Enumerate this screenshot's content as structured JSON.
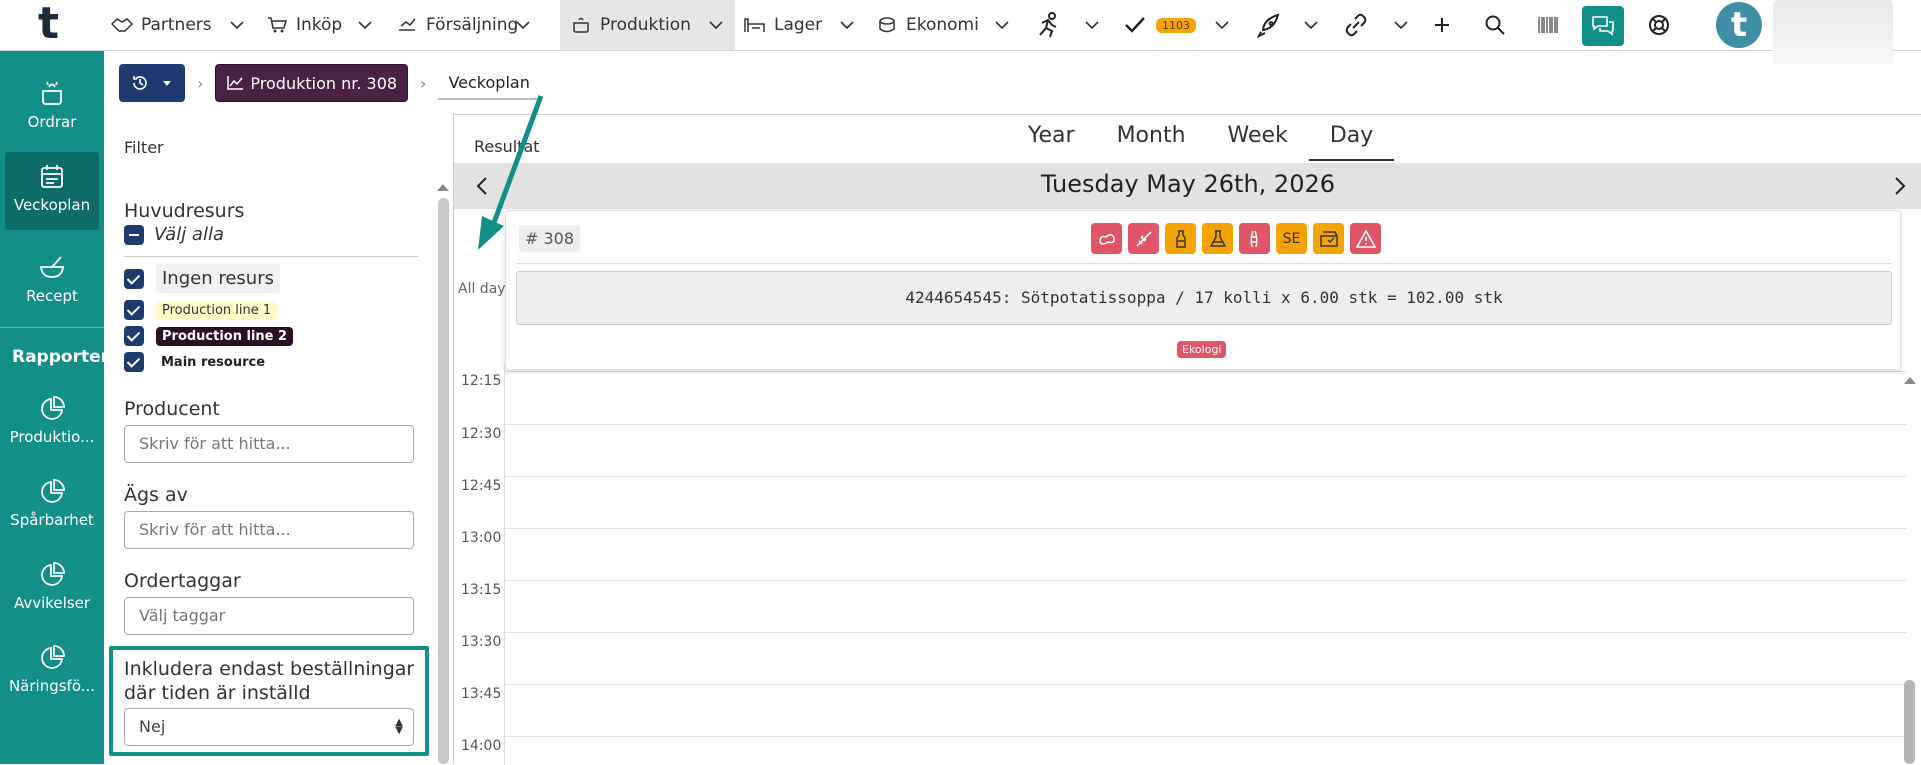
{
  "app": {
    "logo": "t"
  },
  "topnav": {
    "items": [
      {
        "label": "Partners",
        "icon": "handshake-icon"
      },
      {
        "label": "Inköp",
        "icon": "cart-icon"
      },
      {
        "label": "Försäljning",
        "icon": "sales-icon"
      },
      {
        "label": "Produktion",
        "icon": "pot-icon",
        "active": true
      },
      {
        "label": "Lager",
        "icon": "warehouse-icon"
      },
      {
        "label": "Ekonomi",
        "icon": "coins-icon"
      }
    ],
    "tasks_badge": "1103",
    "avatar_letter": "t"
  },
  "sidebar": {
    "items": [
      {
        "label": "Ordrar",
        "icon": "pot-icon"
      },
      {
        "label": "Veckoplan",
        "icon": "calendar-icon",
        "active": true
      },
      {
        "label": "Recept",
        "icon": "bowl-icon"
      }
    ],
    "reports_heading": "Rapporter",
    "reports": [
      {
        "label": "Produktio...",
        "icon": "pie-chart-icon"
      },
      {
        "label": "Spårbarhet",
        "icon": "pie-chart-icon"
      },
      {
        "label": "Avvikelser",
        "icon": "pie-chart-icon"
      },
      {
        "label": "Näringsfö...",
        "icon": "pie-chart-icon"
      }
    ]
  },
  "breadcrumb": {
    "production": "Produktion nr. 308",
    "current": "Veckoplan"
  },
  "filter": {
    "title": "Filter",
    "huvudresurs_label": "Huvudresurs",
    "select_all": "Välj alla",
    "resources": [
      "Ingen resurs",
      "Production line 1",
      "Production line 2",
      "Main resource"
    ],
    "producent_label": "Producent",
    "producent_placeholder": "Skriv för att hitta...",
    "ags_av_label": "Ägs av",
    "ags_av_placeholder": "Skriv för att hitta...",
    "ordertaggar_label": "Ordertaggar",
    "ordertaggar_placeholder": "Välj taggar",
    "include_label_1": "Inkludera endast beställningar",
    "include_label_2": "där tiden är inställd",
    "include_value": "Nej"
  },
  "calendar": {
    "tabs": [
      "Year",
      "Month",
      "Week",
      "Day"
    ],
    "active_tab": "Day",
    "resultat_label": "Resultat",
    "date": "Tuesday May 26th, 2026",
    "allday_label": "All day",
    "times": [
      "12:15",
      "12:30",
      "12:45",
      "13:00",
      "13:15",
      "13:30",
      "13:45",
      "14:00"
    ]
  },
  "event": {
    "order_no": "# 308",
    "description": "4244654545: Sötpotatissoppa / 17 kolli x 6.00 stk = 102.00 stk",
    "tag": "Ekologi",
    "icons": [
      {
        "name": "allergen-gluten-icon",
        "color": "#e05567"
      },
      {
        "name": "allergen-wheat-icon",
        "color": "#e05567"
      },
      {
        "name": "bottle-icon",
        "color": "#f5a300"
      },
      {
        "name": "flask-icon",
        "color": "#f5a300"
      },
      {
        "name": "celery-icon",
        "color": "#e05567"
      },
      {
        "name": "se-label",
        "color": "#f5a300",
        "text": "SE"
      },
      {
        "name": "package-icon",
        "color": "#f5a300"
      },
      {
        "name": "warning-icon",
        "color": "#e05567"
      }
    ]
  },
  "colors": {
    "accent": "#138f8a",
    "navy": "#1e3a6e",
    "plum": "#4a2244"
  }
}
